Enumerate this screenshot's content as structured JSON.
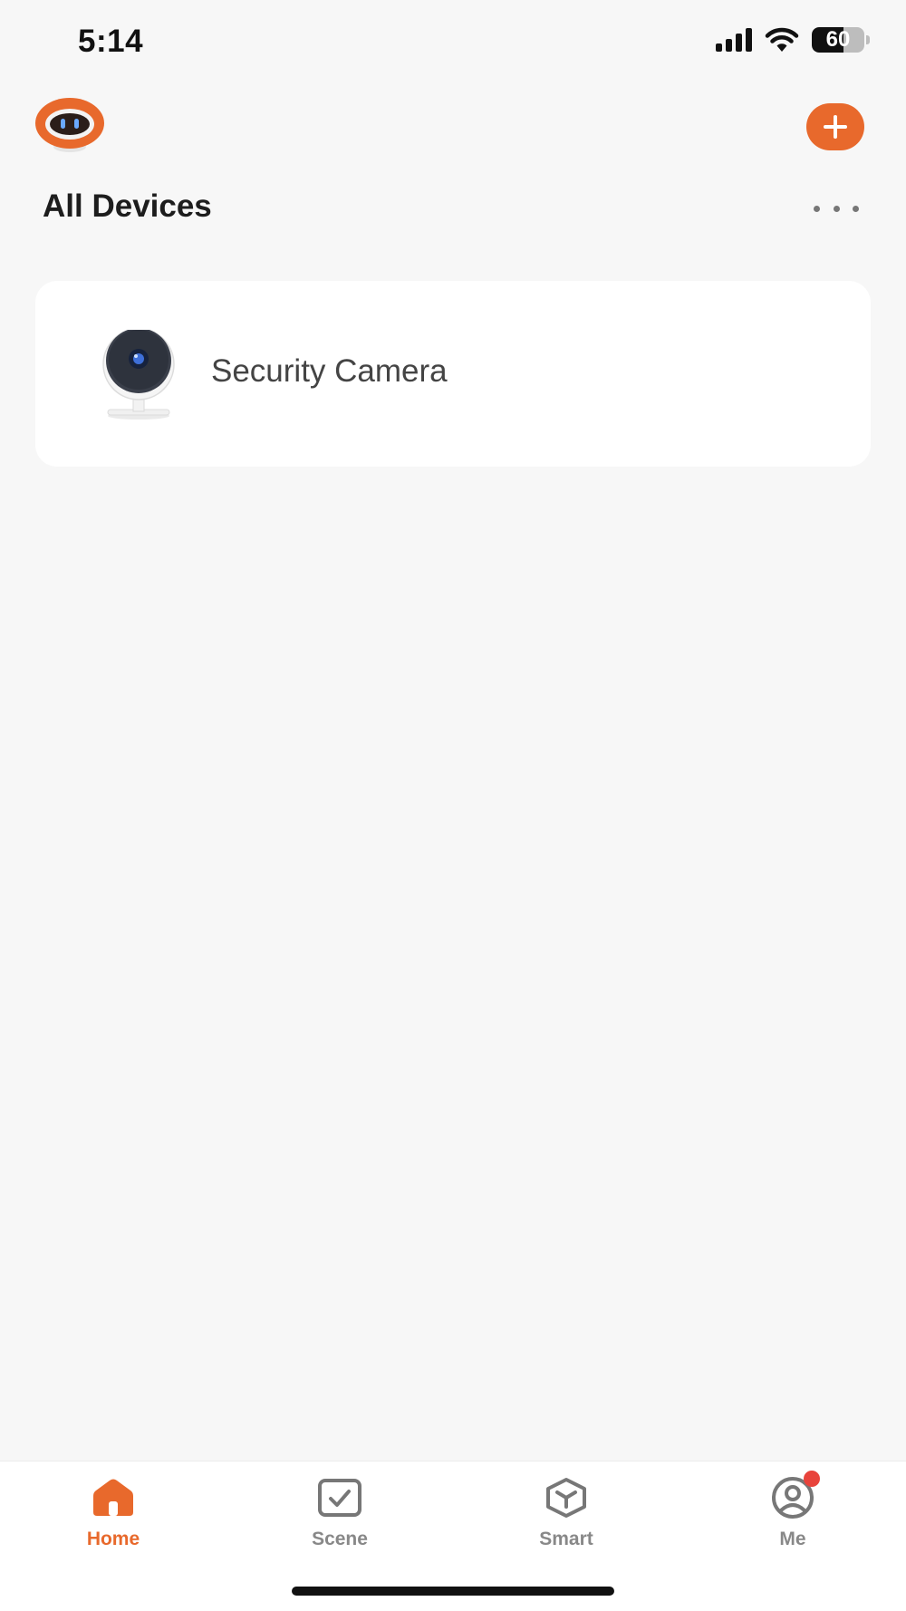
{
  "status_bar": {
    "time": "5:14",
    "battery_level": "60",
    "battery_fraction": 0.6
  },
  "header": {
    "avatar_icon": "robot-avatar-icon",
    "add_icon": "plus-icon",
    "title": "All Devices",
    "more_icon": "more-horizontal-icon"
  },
  "devices": [
    {
      "name": "Security Camera",
      "icon": "security-camera-icon"
    }
  ],
  "tabs": [
    {
      "label": "Home",
      "icon": "home-icon",
      "active": true
    },
    {
      "label": "Scene",
      "icon": "scene-check-icon",
      "active": false
    },
    {
      "label": "Smart",
      "icon": "smart-cube-icon",
      "active": false
    },
    {
      "label": "Me",
      "icon": "user-profile-icon",
      "active": false,
      "notification": true
    }
  ],
  "colors": {
    "accent": "#e8692c",
    "background": "#f7f7f7",
    "card": "#ffffff",
    "notification": "#e8433b",
    "inactive_tab": "#888888"
  }
}
